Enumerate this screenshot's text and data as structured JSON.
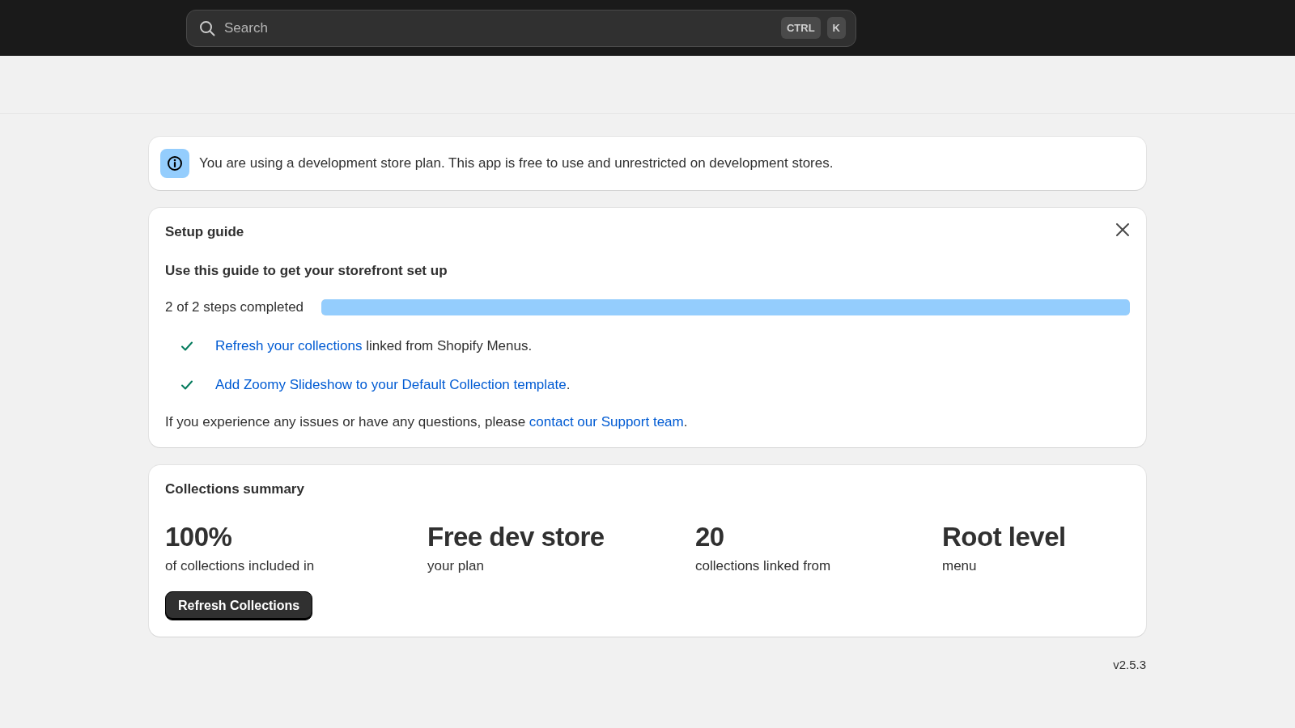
{
  "top_bar": {
    "search": {
      "placeholder": "Search",
      "shortcut_keys": [
        "CTRL",
        "K"
      ]
    }
  },
  "banner": {
    "message": "You are using a development store plan. This app is free to use and unrestricted on development stores."
  },
  "setup_guide": {
    "title": "Setup guide",
    "subtitle": "Use this guide to get your storefront set up",
    "progress_text": "2 of 2 steps completed",
    "level": 1,
    "steps": [
      {
        "checked": true,
        "link": "Refresh your collections",
        "after": " linked from Shopify Menus."
      },
      {
        "checked": true,
        "link": "Add Zoomy Slideshow to your Default Collection template",
        "after": "."
      }
    ],
    "support": {
      "before": "If you experience any issues or have any questions, please ",
      "link": "contact our Support team",
      "after": "."
    }
  },
  "summary": {
    "title": "Collections summary",
    "stats": [
      {
        "value": "100%",
        "label": "of collections included in"
      },
      {
        "value": "Free dev store",
        "label": "your plan"
      },
      {
        "value": "20",
        "label": "collections linked from"
      },
      {
        "value": "Root level",
        "label": "menu"
      }
    ],
    "button": "Refresh Collections"
  },
  "version": "v2.5.3"
}
